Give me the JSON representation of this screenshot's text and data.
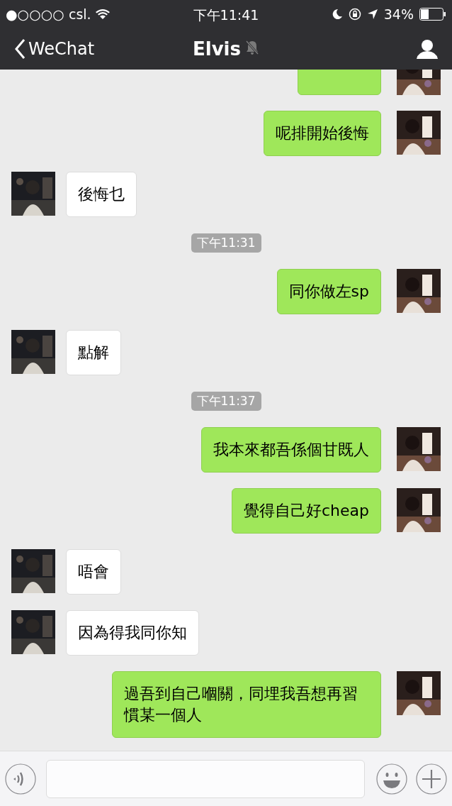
{
  "status_bar": {
    "carrier": "●○○○○ csl.",
    "time": "下午11:41",
    "battery": "34%"
  },
  "nav": {
    "back": "WeChat",
    "title": "Elvis",
    "muted": true
  },
  "messages": [
    {
      "kind": "sent",
      "partial": true
    },
    {
      "kind": "sent",
      "text": "呢排開始後悔"
    },
    {
      "kind": "received",
      "text": "後悔乜"
    },
    {
      "kind": "time",
      "text": "下午11:31"
    },
    {
      "kind": "sent",
      "text": "同你做左sp"
    },
    {
      "kind": "received",
      "text": "點解"
    },
    {
      "kind": "time",
      "text": "下午11:37"
    },
    {
      "kind": "sent",
      "text": "我本來都吾係個甘既人"
    },
    {
      "kind": "sent",
      "text": "覺得自己好cheap"
    },
    {
      "kind": "received",
      "text": "唔會"
    },
    {
      "kind": "received",
      "text": "因為得我同你知"
    },
    {
      "kind": "sent",
      "text": "過吾到自己嗰關，同埋我吾想再習慣某一個人"
    }
  ]
}
